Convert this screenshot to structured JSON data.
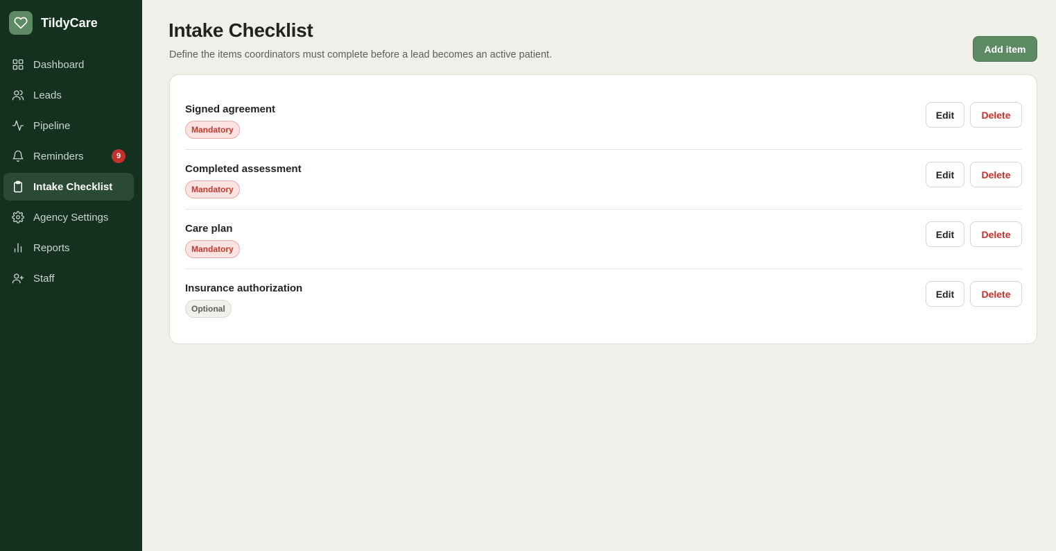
{
  "app": {
    "name": "TildyCare",
    "logo_icon": "heart-icon"
  },
  "colors": {
    "sidebar_bg": "#14301f",
    "accent": "#5b8a63",
    "danger": "#c4302b",
    "background": "#f0efea"
  },
  "sidebar": {
    "items": [
      {
        "label": "Dashboard",
        "icon": "grid-icon",
        "active": false
      },
      {
        "label": "Leads",
        "icon": "users-icon",
        "active": false
      },
      {
        "label": "Pipeline",
        "icon": "activity-icon",
        "active": false
      },
      {
        "label": "Reminders",
        "icon": "bell-icon",
        "active": false,
        "badge": "9"
      },
      {
        "label": "Intake Checklist",
        "icon": "clipboard-icon",
        "active": true
      },
      {
        "label": "Agency Settings",
        "icon": "gear-icon",
        "active": false
      },
      {
        "label": "Reports",
        "icon": "bar-chart-icon",
        "active": false
      },
      {
        "label": "Staff",
        "icon": "user-plus-icon",
        "active": false
      }
    ]
  },
  "header": {
    "title": "Intake Checklist",
    "subtitle": "Define the items coordinators must complete before a lead becomes an active patient.",
    "add_label": "Add item"
  },
  "checklist": {
    "edit_label": "Edit",
    "delete_label": "Delete",
    "items": [
      {
        "title": "Signed agreement",
        "tag": "Mandatory"
      },
      {
        "title": "Completed assessment",
        "tag": "Mandatory"
      },
      {
        "title": "Care plan",
        "tag": "Mandatory"
      },
      {
        "title": "Insurance authorization",
        "tag": "Optional"
      }
    ]
  }
}
